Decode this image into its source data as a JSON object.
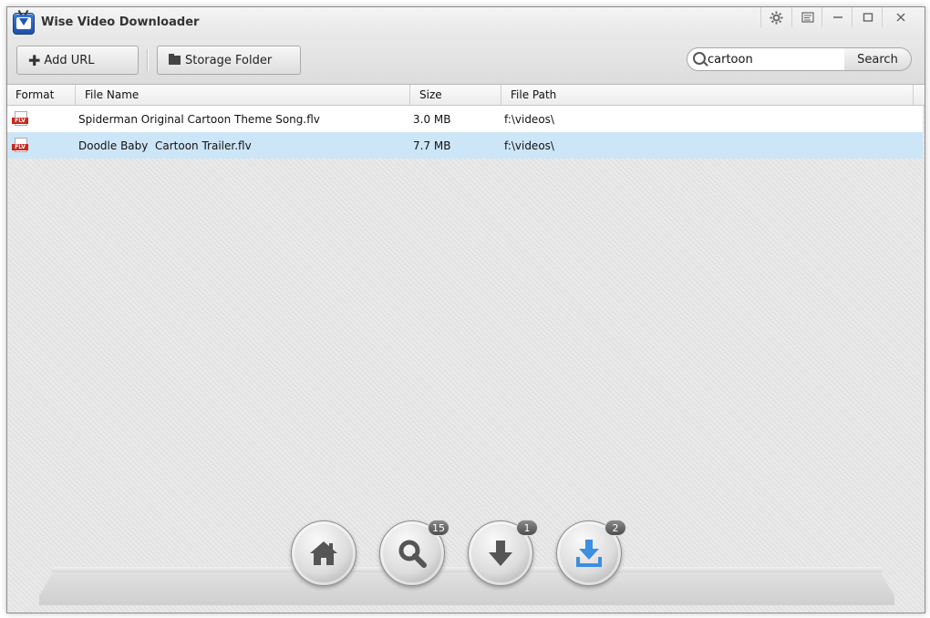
{
  "window": {
    "title": "Wise Video Downloader"
  },
  "toolbar": {
    "add_url_label": "Add URL",
    "storage_folder_label": "Storage Folder",
    "search_value": "cartoon",
    "search_button_label": "Search"
  },
  "table": {
    "headers": {
      "format": "Format",
      "file_name": "File Name",
      "size": "Size",
      "file_path": "File Path"
    },
    "rows": [
      {
        "format": "FLV",
        "file_name": "Spiderman Original Cartoon Theme Song.flv",
        "size": "3.0 MB",
        "file_path": "f:\\videos\\",
        "selected": false
      },
      {
        "format": "FLV",
        "file_name": "Doodle Baby  Cartoon Trailer.flv",
        "size": "7.7 MB",
        "file_path": "f:\\videos\\",
        "selected": true
      }
    ]
  },
  "nav": {
    "home": {
      "icon": "home-icon"
    },
    "search": {
      "icon": "magnifier-icon",
      "badge": "15"
    },
    "downloading": {
      "icon": "download-arrow-icon",
      "badge": "1"
    },
    "downloaded": {
      "icon": "downloaded-tray-icon",
      "badge": "2"
    }
  },
  "colors": {
    "selected_row": "#cde6f7",
    "accent_blue": "#3d8fe0",
    "flv_red": "#c8281e"
  }
}
